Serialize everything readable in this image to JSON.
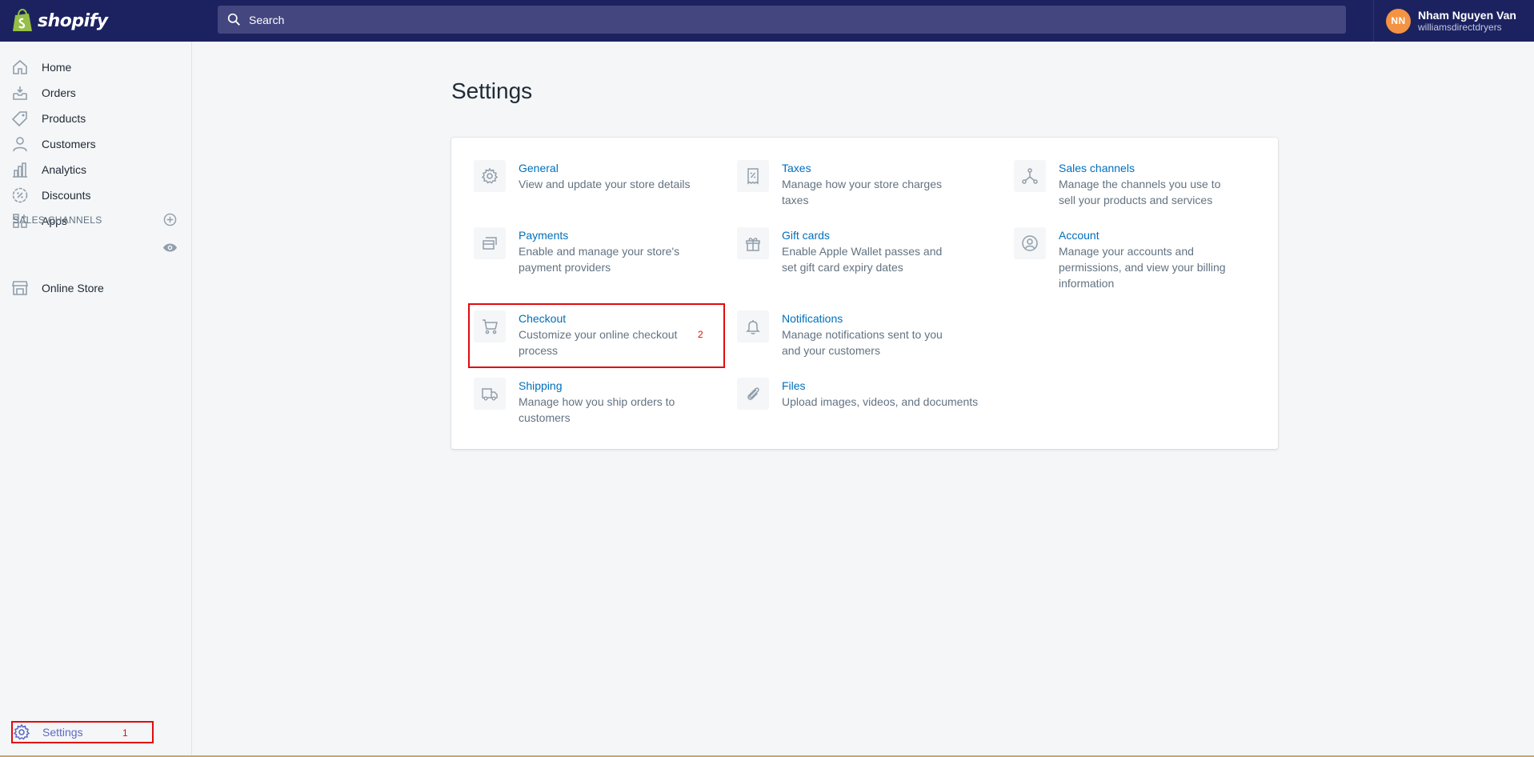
{
  "topbar": {
    "brand": "shopify",
    "search_placeholder": "Search",
    "user": {
      "initials": "NN",
      "name": "Nham Nguyen Van",
      "store": "williamsdirectdryers"
    }
  },
  "sidebar": {
    "items": [
      {
        "label": "Home",
        "icon": "home-icon"
      },
      {
        "label": "Orders",
        "icon": "orders-icon"
      },
      {
        "label": "Products",
        "icon": "tag-icon"
      },
      {
        "label": "Customers",
        "icon": "person-icon"
      },
      {
        "label": "Analytics",
        "icon": "bar-chart-icon"
      },
      {
        "label": "Discounts",
        "icon": "discount-icon"
      },
      {
        "label": "Apps",
        "icon": "apps-icon"
      }
    ],
    "sales_channels_title": "SALES CHANNELS",
    "online_store": "Online Store",
    "settings": "Settings",
    "annotation_1": "1"
  },
  "main": {
    "title": "Settings",
    "tiles": [
      {
        "title": "General",
        "desc": "View and update your store details",
        "icon": "gear-icon"
      },
      {
        "title": "Taxes",
        "desc": "Manage how your store charges taxes",
        "icon": "receipt-icon"
      },
      {
        "title": "Sales channels",
        "desc": "Manage the channels you use to sell your products and services",
        "icon": "channels-icon"
      },
      {
        "title": "Payments",
        "desc": "Enable and manage your store's payment providers",
        "icon": "payments-icon"
      },
      {
        "title": "Gift cards",
        "desc": "Enable Apple Wallet passes and set gift card expiry dates",
        "icon": "gift-icon"
      },
      {
        "title": "Account",
        "desc": "Manage your accounts and permissions, and view your billing information",
        "icon": "account-icon"
      },
      {
        "title": "Checkout",
        "desc": "Customize your online checkout process",
        "icon": "cart-icon"
      },
      {
        "title": "Notifications",
        "desc": "Manage notifications sent to you and your customers",
        "icon": "bell-icon"
      },
      {
        "title": "Shipping",
        "desc": "Manage how you ship orders to customers",
        "icon": "truck-icon"
      },
      {
        "title": "Files",
        "desc": "Upload images, videos, and documents",
        "icon": "paperclip-icon"
      }
    ],
    "annotation_2": "2"
  },
  "colors": {
    "topbar": "#1c2260",
    "link": "#006fbb",
    "highlight": "#e20b0b",
    "settings_active": "#5c6ac4"
  }
}
